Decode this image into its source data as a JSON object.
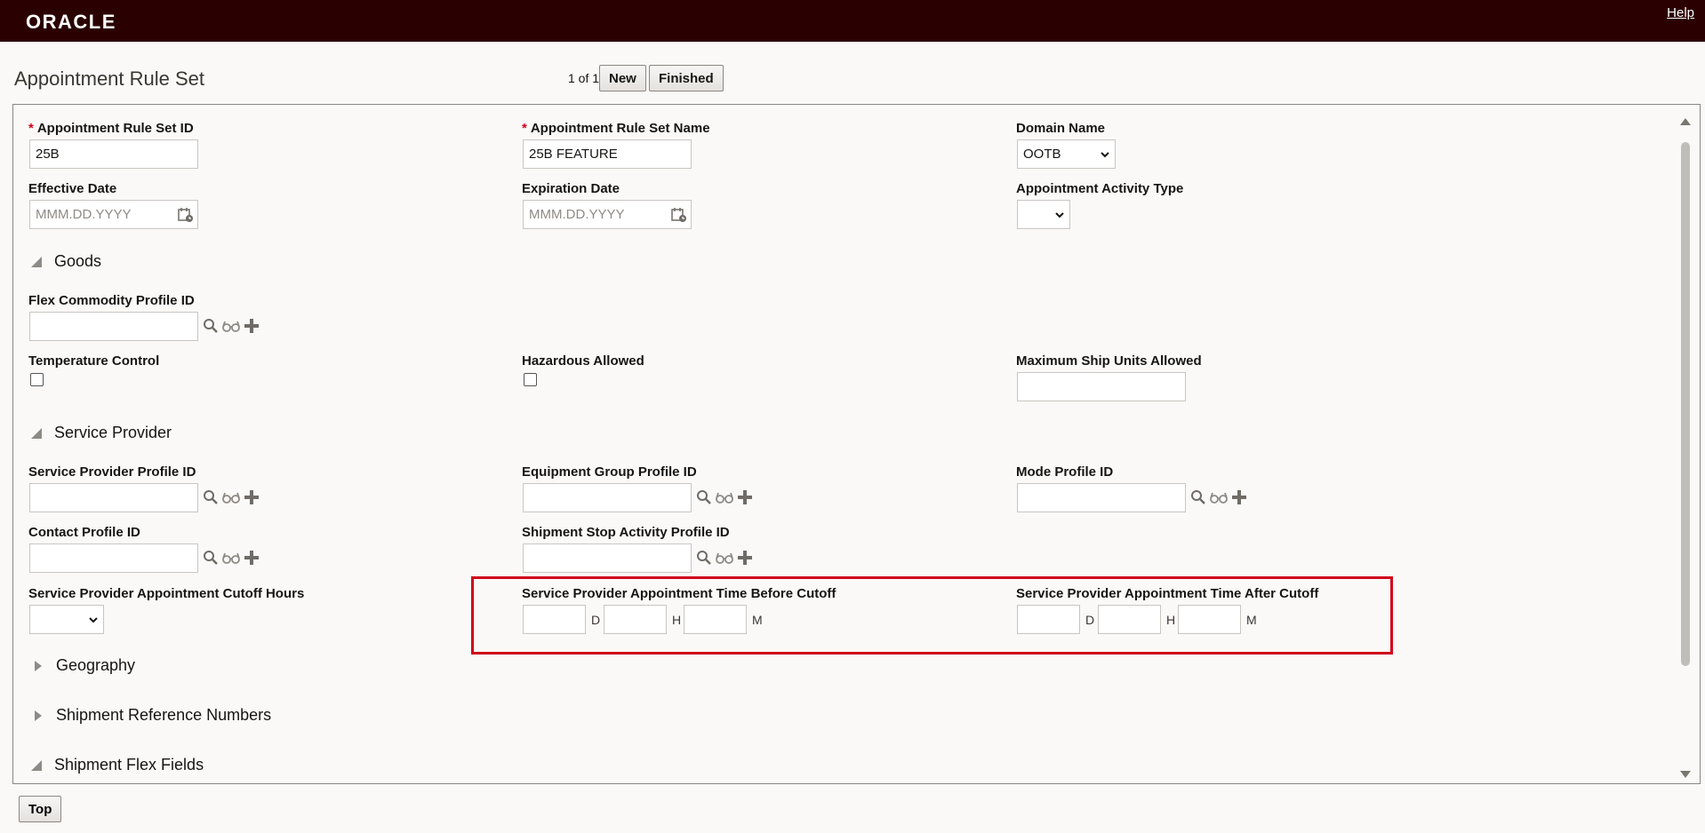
{
  "header": {
    "logo": "ORACLE",
    "help": "Help"
  },
  "page": {
    "title": "Appointment Rule Set",
    "pager": "1 of 1",
    "new_label": "New",
    "finished_label": "Finished"
  },
  "fields": {
    "rule_set_id": {
      "label": "Appointment Rule Set ID",
      "value": "25B"
    },
    "rule_set_name": {
      "label": "Appointment Rule Set Name",
      "value": "25B FEATURE"
    },
    "domain_name": {
      "label": "Domain Name",
      "value": "OOTB"
    },
    "effective_date": {
      "label": "Effective Date",
      "placeholder": "MMM.DD.YYYY"
    },
    "expiration_date": {
      "label": "Expiration Date",
      "placeholder": "MMM.DD.YYYY"
    },
    "activity_type": {
      "label": "Appointment Activity Type",
      "value": ""
    }
  },
  "goods": {
    "title": "Goods",
    "flex_commodity": {
      "label": "Flex Commodity Profile ID",
      "value": ""
    },
    "temperature_control": {
      "label": "Temperature Control"
    },
    "hazardous_allowed": {
      "label": "Hazardous Allowed"
    },
    "max_ship_units": {
      "label": "Maximum Ship Units Allowed",
      "value": ""
    }
  },
  "service_provider": {
    "title": "Service Provider",
    "sp_profile": {
      "label": "Service Provider Profile ID",
      "value": ""
    },
    "equipment_group": {
      "label": "Equipment Group Profile ID",
      "value": ""
    },
    "mode_profile": {
      "label": "Mode Profile ID",
      "value": ""
    },
    "contact_profile": {
      "label": "Contact Profile ID",
      "value": ""
    },
    "stop_activity": {
      "label": "Shipment Stop Activity Profile ID",
      "value": ""
    },
    "cutoff_hours": {
      "label": "Service Provider Appointment Cutoff Hours",
      "value": ""
    },
    "time_before": {
      "label": "Service Provider Appointment Time Before Cutoff"
    },
    "time_after": {
      "label": "Service Provider Appointment Time After Cutoff"
    },
    "units": {
      "d": "D",
      "h": "H",
      "m": "M"
    }
  },
  "sections": {
    "geography": "Geography",
    "shipment_refs": "Shipment Reference Numbers",
    "shipment_flex": "Shipment Flex Fields"
  },
  "footer": {
    "top_label": "Top"
  }
}
